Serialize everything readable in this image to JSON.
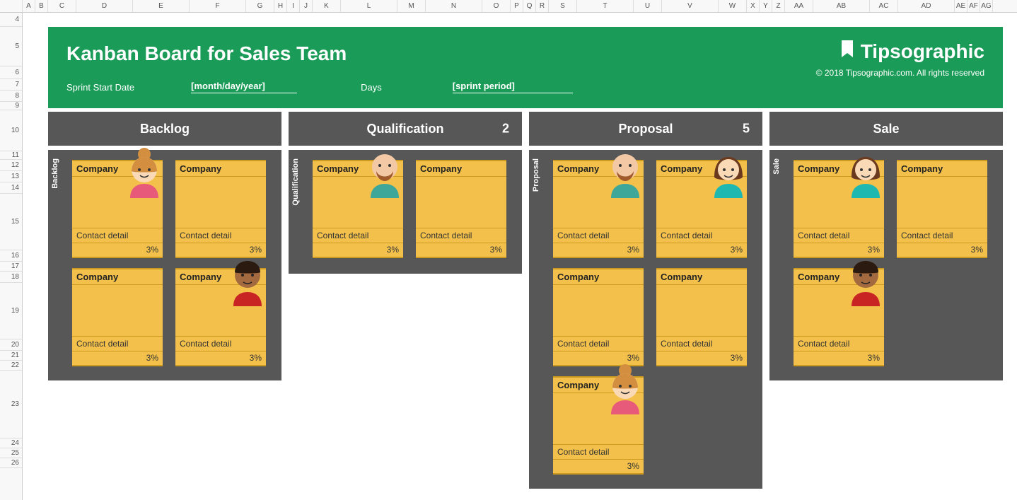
{
  "spreadsheet": {
    "columns": [
      "",
      "A",
      "B",
      "C",
      "D",
      "E",
      "F",
      "G",
      "H",
      "I",
      "J",
      "K",
      "L",
      "M",
      "N",
      "O",
      "P",
      "Q",
      "R",
      "S",
      "T",
      "U",
      "V",
      "W",
      "X",
      "Y",
      "Z",
      "AA",
      "AB",
      "AC",
      "AD",
      "AE",
      "AF",
      "AG"
    ],
    "rows": [
      "4",
      "5",
      "6",
      "7",
      "8",
      "9",
      "10",
      "11",
      "12",
      "13",
      "14",
      "15",
      "16",
      "17",
      "18",
      "19",
      "20",
      "21",
      "22",
      "23",
      "24",
      "25",
      "26"
    ]
  },
  "header": {
    "title": "Kanban Board for Sales Team",
    "brand": "Tipsographic",
    "copyright": "© 2018 Tipsographic.com. All rights reserved",
    "sprint_start_label": "Sprint Start Date",
    "sprint_start_value": "[month/day/year]",
    "days_label": "Days",
    "sprint_period_value": "[sprint period]"
  },
  "lanes": [
    {
      "title": "Backlog",
      "label": "Backlog",
      "count": "",
      "cards": [
        {
          "company": "Company",
          "contact": "Contact detail",
          "pct": "3%",
          "avatar": "woman-bun"
        },
        {
          "company": "Company",
          "contact": "Contact detail",
          "pct": "3%",
          "avatar": null
        },
        {
          "company": "Company",
          "contact": "Contact detail",
          "pct": "3%",
          "avatar": null
        },
        {
          "company": "Company",
          "contact": "Contact detail",
          "pct": "3%",
          "avatar": "man-dark"
        }
      ]
    },
    {
      "title": "Qualification",
      "label": "Qualification",
      "count": "2",
      "cards": [
        {
          "company": "Company",
          "contact": "Contact detail",
          "pct": "3%",
          "avatar": "man-bald"
        },
        {
          "company": "Company",
          "contact": "Contact detail",
          "pct": "3%",
          "avatar": null
        }
      ]
    },
    {
      "title": "Proposal",
      "label": "Proposal",
      "count": "5",
      "cards": [
        {
          "company": "Company",
          "contact": "Contact detail",
          "pct": "3%",
          "avatar": "man-bald"
        },
        {
          "company": "Company",
          "contact": "Contact detail",
          "pct": "3%",
          "avatar": "woman-brown"
        },
        {
          "company": "Company",
          "contact": "Contact detail",
          "pct": "3%",
          "avatar": null
        },
        {
          "company": "Company",
          "contact": "Contact detail",
          "pct": "3%",
          "avatar": null
        },
        {
          "company": "Company",
          "contact": "Contact detail",
          "pct": "3%",
          "avatar": "woman-bun"
        }
      ]
    },
    {
      "title": "Sale",
      "label": "Sale",
      "count": "",
      "cards": [
        {
          "company": "Company",
          "contact": "Contact detail",
          "pct": "3%",
          "avatar": "woman-brown"
        },
        {
          "company": "Company",
          "contact": "Contact detail",
          "pct": "3%",
          "avatar": null
        },
        {
          "company": "Company",
          "contact": "Contact detail",
          "pct": "3%",
          "avatar": "man-dark"
        }
      ]
    }
  ]
}
